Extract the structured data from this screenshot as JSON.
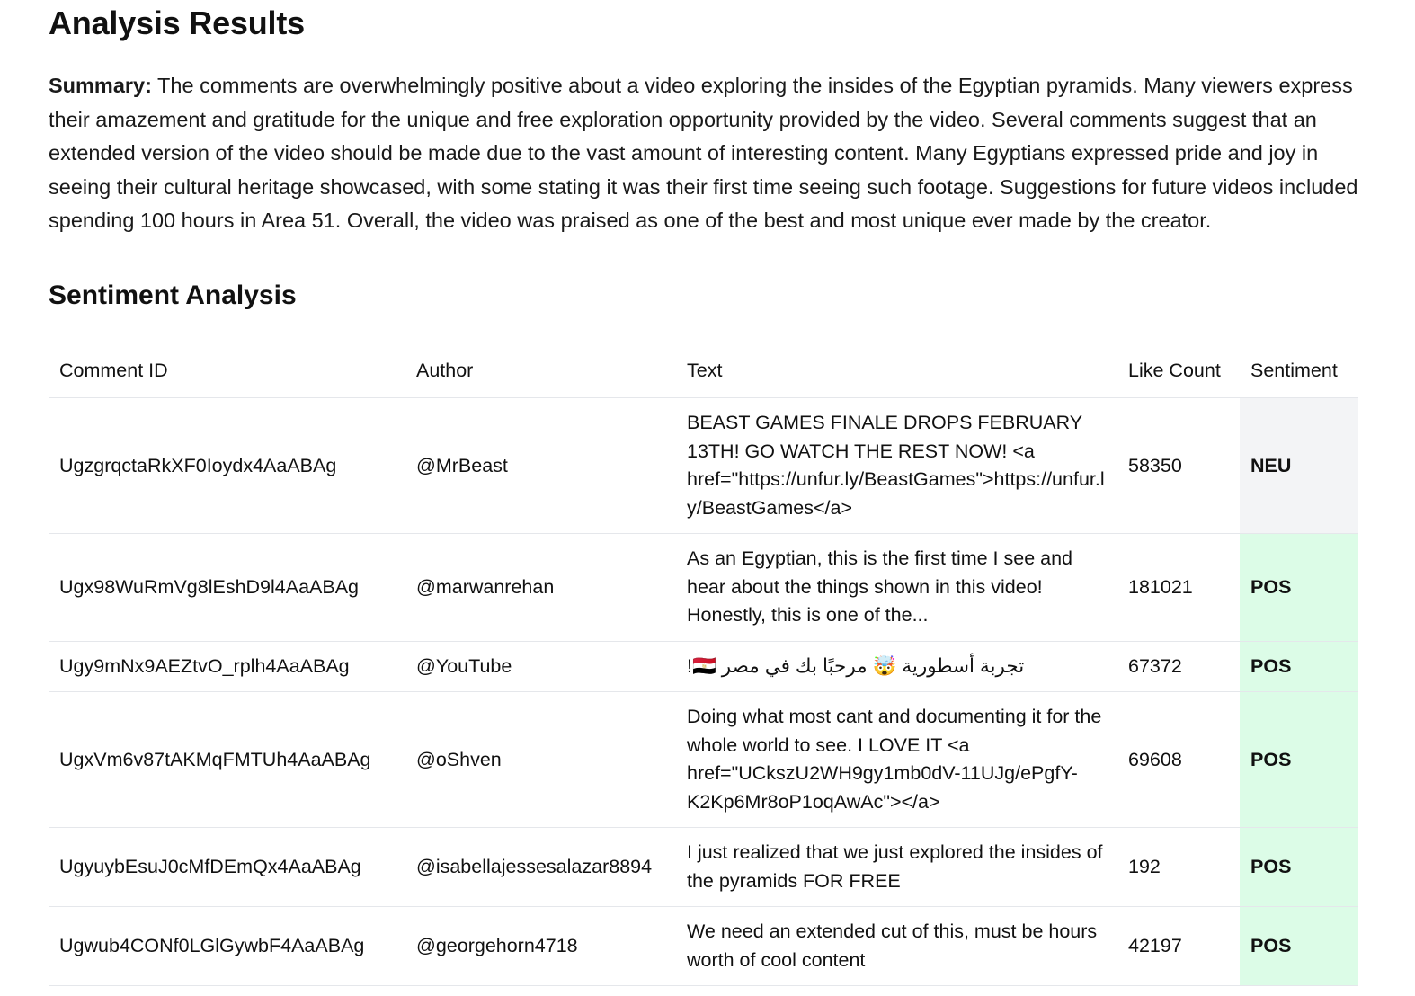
{
  "page_title": "Analysis Results",
  "summary": {
    "label": "Summary:",
    "text": " The comments are overwhelmingly positive about a video exploring the insides of the Egyptian pyramids. Many viewers express their amazement and gratitude for the unique and free exploration opportunity provided by the video. Several comments suggest that an extended version of the video should be made due to the vast amount of interesting content. Many Egyptians expressed pride and joy in seeing their cultural heritage showcased, with some stating it was their first time seeing such footage. Suggestions for future videos included spending 100 hours in Area 51. Overall, the video was praised as one of the best and most unique ever made by the creator."
  },
  "sentiment_section": {
    "title": "Sentiment Analysis",
    "columns": [
      "Comment ID",
      "Author",
      "Text",
      "Like Count",
      "Sentiment"
    ],
    "rows": [
      {
        "comment_id": "UgzgrqctaRkXF0Ioydx4AaABAg",
        "author": "@MrBeast",
        "text": "BEAST GAMES FINALE DROPS FEBRUARY 13TH! GO WATCH THE REST NOW! <a href=\"https://unfur.ly/BeastGames\">https://unfur.ly/BeastGames</a>",
        "like_count": "58350",
        "sentiment": "NEU"
      },
      {
        "comment_id": "Ugx98WuRmVg8lEshD9l4AaABAg",
        "author": "@marwanrehan",
        "text": "As an Egyptian, this is the first time I see and hear about the things shown in this video! Honestly, this is one of the...",
        "like_count": "181021",
        "sentiment": "POS"
      },
      {
        "comment_id": "Ugy9mNx9AEZtvO_rplh4AaABAg",
        "author": "@YouTube",
        "text": "تجربة أسطورية 🤯 مرحبًا بك في مصر 🇪🇬!",
        "like_count": "67372",
        "sentiment": "POS"
      },
      {
        "comment_id": "UgxVm6v87tAKMqFMTUh4AaABAg",
        "author": "@oShven",
        "text": "Doing what most cant and documenting it for the whole world to see. I LOVE IT <a href=\"UCkszU2WH9gy1mb0dV-11UJg/ePgfY-K2Kp6Mr8oP1oqAwAc\"></a>",
        "like_count": "69608",
        "sentiment": "POS"
      },
      {
        "comment_id": "UgyuybEsuJ0cMfDEmQx4AaABAg",
        "author": "@isabellajessesalazar8894",
        "text": "I just realized that we just explored the insides of the pyramids FOR FREE",
        "like_count": "192",
        "sentiment": "POS"
      },
      {
        "comment_id": "Ugwub4CONf0LGlGywbF4AaABAg",
        "author": "@georgehorn4718",
        "text": "We need an extended cut of this, must be hours worth of cool content",
        "like_count": "42197",
        "sentiment": "POS"
      }
    ]
  },
  "colors": {
    "neutral_bg": "#f3f4f6",
    "positive_bg": "#dcfce7",
    "divider": "#e5e7eb"
  }
}
